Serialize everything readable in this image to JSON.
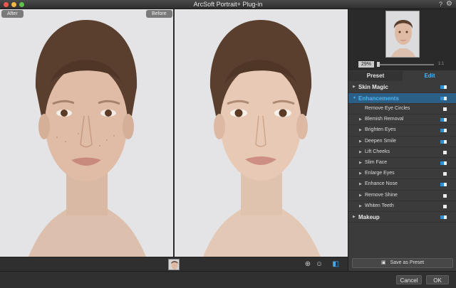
{
  "window": {
    "title": "ArcSoft Portrait+ Plug-in",
    "help_label": "?",
    "settings_icon": "gear-icon"
  },
  "preview": {
    "before_label": "Before",
    "after_label": "After"
  },
  "navigator": {
    "zoom_value": "29%",
    "zoom_max_label": "1:1"
  },
  "tabs": {
    "preset": "Preset",
    "edit": "Edit"
  },
  "panel": {
    "skin_magic": "Skin Magic",
    "enhancements": "Enhancements",
    "items": [
      {
        "label": "Remove Eye Circles"
      },
      {
        "label": "Blemish Removal"
      },
      {
        "label": "Brighten Eyes"
      },
      {
        "label": "Deepen Smile"
      },
      {
        "label": "Lift Cheeks"
      },
      {
        "label": "Slim Face"
      },
      {
        "label": "Enlarge Eyes"
      },
      {
        "label": "Enhance Nose"
      },
      {
        "label": "Remove Shine"
      },
      {
        "label": "Whiten Teeth"
      }
    ],
    "makeup": "Makeup",
    "save_preset": "Save as Preset"
  },
  "footer": {
    "cancel": "Cancel",
    "ok": "OK"
  },
  "colors": {
    "accent": "#4eb4f0",
    "active_row": "#2b5f86"
  }
}
